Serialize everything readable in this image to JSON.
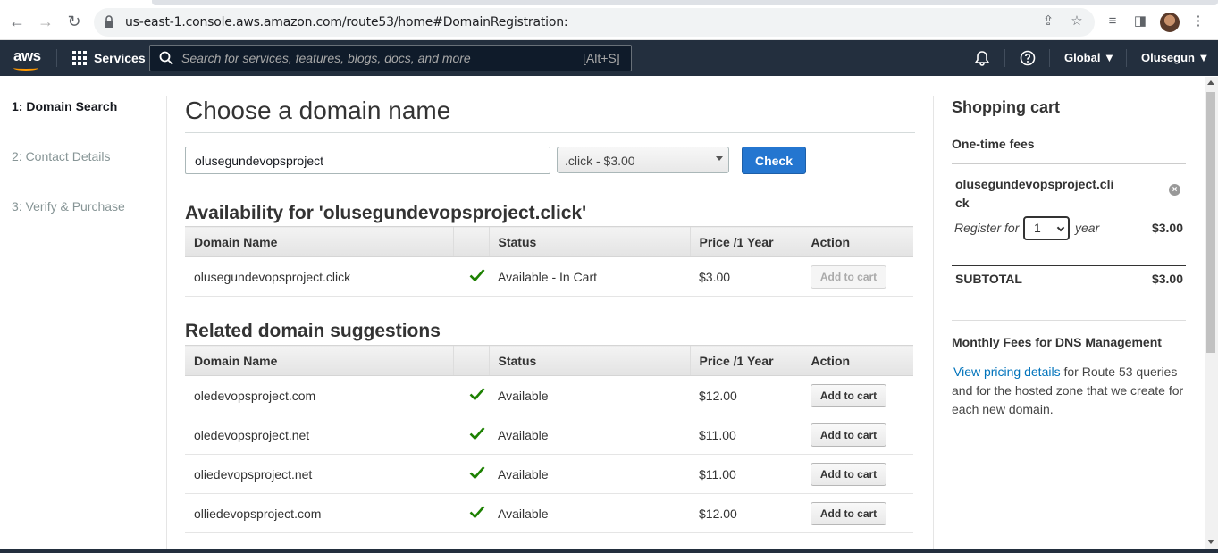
{
  "browser": {
    "url": "us-east-1.console.aws.amazon.com/route53/home#DomainRegistration:"
  },
  "aws_nav": {
    "logo": "aws",
    "services_label": "Services",
    "search_placeholder": "Search for services, features, blogs, docs, and more",
    "search_shortcut": "[Alt+S]",
    "region": "Global ▼",
    "user": "Olusegun ▼"
  },
  "steps": [
    {
      "label": "1: Domain Search",
      "active": true
    },
    {
      "label": "2: Contact Details",
      "active": false
    },
    {
      "label": "3: Verify & Purchase",
      "active": false
    }
  ],
  "main": {
    "title": "Choose a domain name",
    "domain_input_value": "olusegundevopsproject",
    "tld_selected": ".click - $3.00",
    "check_label": "Check",
    "availability_title": "Availability for 'olusegundevopsproject.click'",
    "columns": {
      "domain": "Domain Name",
      "status": "Status",
      "price": "Price /1 Year",
      "action": "Action"
    },
    "availability_row": {
      "domain": "olusegundevopsproject.click",
      "status": "Available - In Cart",
      "price": "$3.00",
      "action": "Add to cart"
    },
    "related_title": "Related domain suggestions",
    "suggestions": [
      {
        "domain": "oledevopsproject.com",
        "status": "Available",
        "price": "$12.00",
        "action": "Add to cart"
      },
      {
        "domain": "oledevopsproject.net",
        "status": "Available",
        "price": "$11.00",
        "action": "Add to cart"
      },
      {
        "domain": "oliedevopsproject.net",
        "status": "Available",
        "price": "$11.00",
        "action": "Add to cart"
      },
      {
        "domain": "olliedevopsproject.com",
        "status": "Available",
        "price": "$12.00",
        "action": "Add to cart"
      }
    ]
  },
  "cart": {
    "title": "Shopping cart",
    "one_time_fees": "One-time fees",
    "item_domain": "olusegundevopsproject.click",
    "register_for": "Register for",
    "years": "1",
    "year_word": "year",
    "item_price": "$3.00",
    "subtotal_label": "SUBTOTAL",
    "subtotal_value": "$3.00",
    "monthly_title": "Monthly Fees for DNS Management",
    "pricing_link": "View pricing details",
    "monthly_text": " for Route 53 queries and for the hosted zone that we create for each new domain."
  },
  "colors": {
    "aws_nav_bg": "#232f3e",
    "aws_orange": "#ff9900",
    "primary_button": "#2476d0",
    "check_green": "#1d8102",
    "link": "#0073bb"
  }
}
